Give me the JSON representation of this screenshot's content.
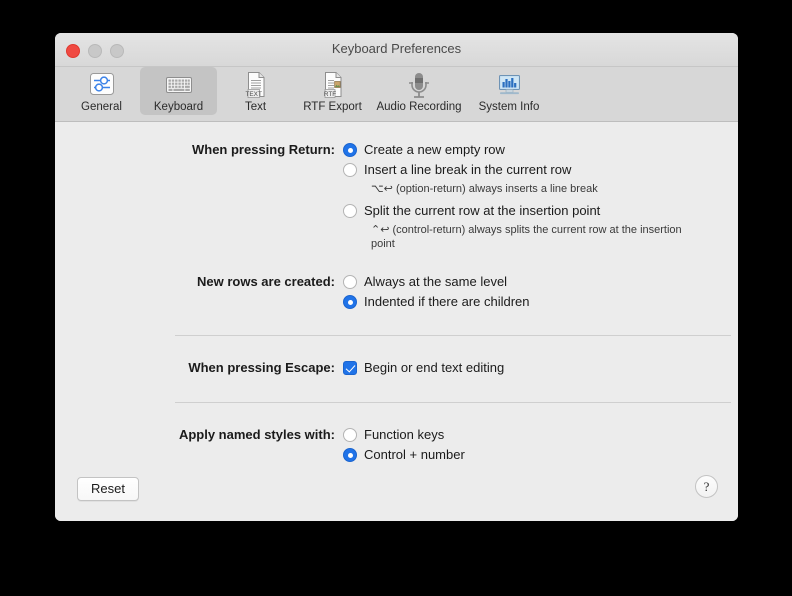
{
  "window": {
    "title": "Keyboard Preferences",
    "traffic_lights": [
      "close-button",
      "minimize-button",
      "maximize-button"
    ]
  },
  "toolbar": {
    "items": [
      {
        "label": "General",
        "icon": "sliders-icon",
        "selected": false
      },
      {
        "label": "Keyboard",
        "icon": "keyboard-icon",
        "selected": true
      },
      {
        "label": "Text",
        "icon": "text-document-icon",
        "selected": false
      },
      {
        "label": "RTF Export",
        "icon": "rtf-document-icon",
        "selected": false
      },
      {
        "label": "Audio Recording",
        "icon": "microphone-icon",
        "selected": false
      },
      {
        "label": "System Info",
        "icon": "monitor-chart-icon",
        "selected": false
      }
    ]
  },
  "sections": {
    "return": {
      "label": "When pressing Return:",
      "options": [
        {
          "text": "Create a new empty row",
          "selected": true
        },
        {
          "text": "Insert a line break in the current row",
          "selected": false
        },
        {
          "text": "Split the current row at the insertion point",
          "selected": false
        }
      ],
      "hint_option_return": "⌥↩ (option-return) always inserts a line break",
      "hint_control_return": "⌃↩ (control-return) always splits the current row at the insertion point"
    },
    "new_rows": {
      "label": "New rows are created:",
      "options": [
        {
          "text": "Always at the same level",
          "selected": false
        },
        {
          "text": "Indented if there are children",
          "selected": true
        }
      ]
    },
    "escape": {
      "label": "When pressing Escape:",
      "checkbox": {
        "text": "Begin or end text editing",
        "checked": true
      }
    },
    "named_styles": {
      "label": "Apply named styles with:",
      "options": [
        {
          "text": "Function keys",
          "selected": false
        },
        {
          "text": "Control + number",
          "selected": true
        }
      ]
    }
  },
  "bottom_bar": {
    "reset_label": "Reset",
    "help_label": "?"
  },
  "colors": {
    "accent": "#2073e8",
    "window_bg": "#ececec",
    "toolbar_bg": "#d7d7d7",
    "text": "#1b1b1b"
  }
}
